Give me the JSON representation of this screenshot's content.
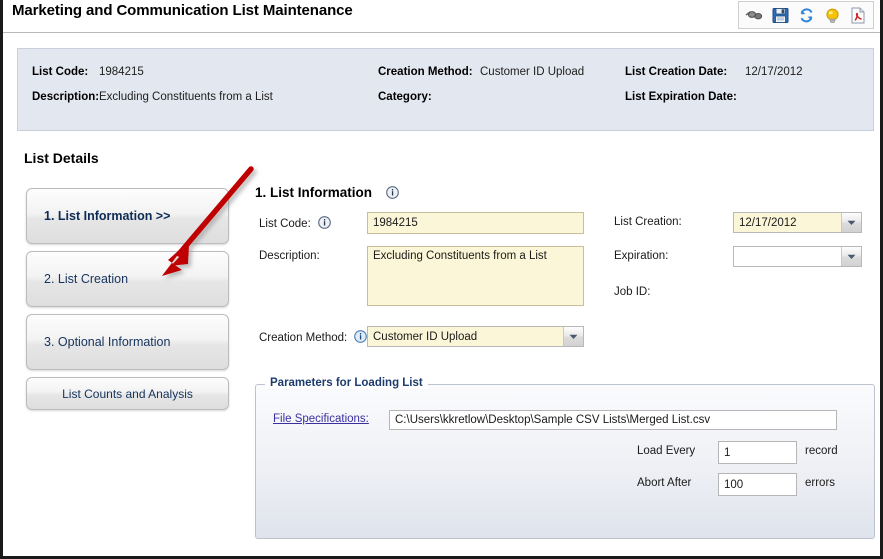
{
  "window": {
    "title": "Marketing and Communication List Maintenance"
  },
  "toolbar": {
    "items": [
      {
        "name": "view-icon",
        "label": "View"
      },
      {
        "name": "save-icon",
        "label": "Save"
      },
      {
        "name": "refresh-icon",
        "label": "Refresh"
      },
      {
        "name": "hint-icon",
        "label": "Hint"
      },
      {
        "name": "pdf-report-icon",
        "label": "Report"
      }
    ]
  },
  "summary": {
    "list_code_label": "List Code:",
    "list_code_value": "1984215",
    "description_label": "Description:",
    "description_value": "Excluding Constituents from a List",
    "creation_method_label": "Creation Method:",
    "creation_method_value": "Customer ID Upload",
    "category_label": "Category:",
    "category_value": "",
    "list_creation_date_label": "List Creation Date:",
    "list_creation_date_value": "12/17/2012",
    "list_expiration_date_label": "List Expiration Date:",
    "list_expiration_date_value": ""
  },
  "details": {
    "heading": "List Details",
    "steps": [
      {
        "label": "1. List Information  >>",
        "active": true
      },
      {
        "label": "2. List Creation",
        "active": false
      },
      {
        "label": "3. Optional Information",
        "active": false
      },
      {
        "label": "List Counts and Analysis",
        "active": false
      }
    ]
  },
  "form": {
    "title": "1. List Information",
    "list_code_label": "List Code:",
    "list_code_value": "1984215",
    "description_label": "Description:",
    "description_value": "Excluding Constituents from a List",
    "creation_method_label": "Creation Method:",
    "creation_method_value": "Customer ID Upload",
    "list_creation_label": "List Creation:",
    "list_creation_value": "12/17/2012",
    "expiration_label": "Expiration:",
    "expiration_value": "",
    "job_id_label": "Job ID:",
    "job_id_value": ""
  },
  "parameters": {
    "legend": "Parameters for Loading List",
    "file_specifications_label": "File Specifications:",
    "file_path_value": "C:\\Users\\kkretlow\\Desktop\\Sample CSV Lists\\Merged List.csv",
    "load_every_label": "Load Every",
    "load_every_value": "1",
    "load_every_unit": "record",
    "abort_after_label": "Abort After",
    "abort_after_value": "100",
    "abort_after_unit": "errors"
  },
  "annotation": {
    "arrow_color": "#c00000",
    "name": "pointer-to-step-2"
  },
  "colors": {
    "info_panel_bg": "#e3e7f0",
    "field_yellow": "#fcf6d8",
    "link": "#3b2fa0",
    "legend": "#1d3c6e"
  }
}
